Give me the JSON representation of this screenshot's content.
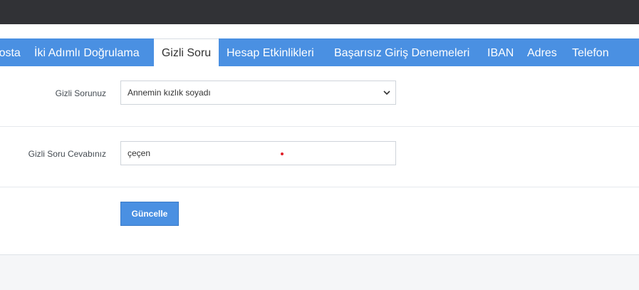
{
  "tabs": [
    {
      "label": "Eposta"
    },
    {
      "label": "İki Adımlı Doğrulama"
    },
    {
      "label": "Gizli Soru",
      "active": true
    },
    {
      "label": "Hesap Etkinlikleri"
    },
    {
      "label": "Başarısız Giriş Denemeleri"
    },
    {
      "label": "IBAN"
    },
    {
      "label": "Adres"
    },
    {
      "label": "Telefon"
    }
  ],
  "form": {
    "question_label": "Gizli Sorunuz",
    "question_value": "Annemin kızlık soyadı",
    "answer_label": "Gizli Soru Cevabınız",
    "answer_value": "çeçen",
    "submit_label": "Güncelle"
  },
  "icons": {
    "select_arrow": "chevron-down-icon"
  },
  "colors": {
    "topbar": "#313236",
    "tabbar": "#4a90e2",
    "button": "#4a90e2",
    "marker_dot": "#e0202a"
  }
}
